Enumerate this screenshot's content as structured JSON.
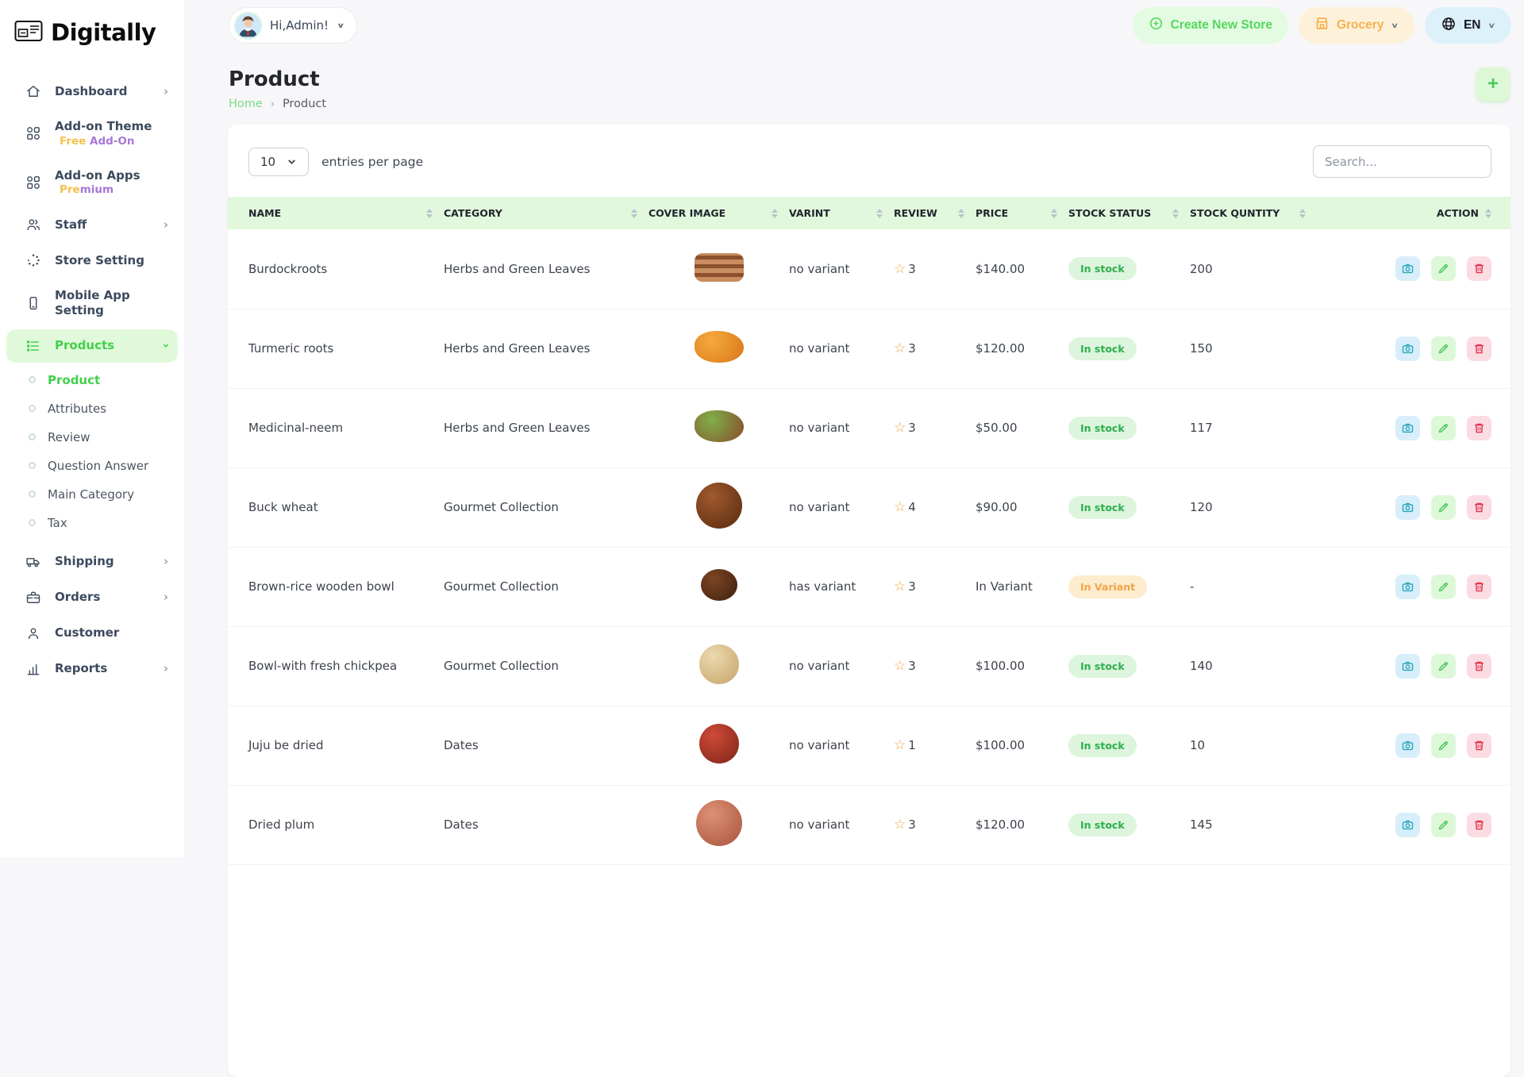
{
  "brand": {
    "name": "Digitally"
  },
  "topbar": {
    "greeting": "Hi,Admin!",
    "create_store_label": "Create New Store",
    "store_label": "Grocery",
    "language_label": "EN"
  },
  "page": {
    "title": "Product",
    "breadcrumb": {
      "home": "Home",
      "current": "Product"
    },
    "add_button": "+"
  },
  "controls": {
    "entries_value": "10",
    "entries_label": "entries per page",
    "search_placeholder": "Search..."
  },
  "sidebar": {
    "items": [
      {
        "label": "Dashboard",
        "icon": "home-icon",
        "chevron": true
      },
      {
        "label": "Add-on Theme",
        "icon": "grid-icon",
        "badge": [
          {
            "text": "Free",
            "color": "#f2c14e"
          },
          {
            "text": " Add-On",
            "color": "#a678d8"
          }
        ]
      },
      {
        "label": "Add-on Apps",
        "icon": "grid-icon",
        "badge": [
          {
            "text": "Pre",
            "color": "#f2c14e"
          },
          {
            "text": "mium",
            "color": "#a678d8"
          }
        ]
      },
      {
        "label": "Staff",
        "icon": "staff-icon",
        "chevron": true
      },
      {
        "label": "Store Setting",
        "icon": "spinner-icon"
      },
      {
        "label": "Mobile App Setting",
        "icon": "mobile-icon"
      },
      {
        "label": "Products",
        "icon": "list-icon",
        "chevron": true,
        "active": true,
        "children": [
          "Product",
          "Attributes",
          "Review",
          "Question Answer",
          "Main Category",
          "Tax"
        ],
        "active_child": "Product"
      },
      {
        "label": "Shipping",
        "icon": "truck-icon",
        "chevron": true
      },
      {
        "label": "Orders",
        "icon": "briefcase-icon",
        "chevron": true
      },
      {
        "label": "Customer",
        "icon": "customer-icon"
      },
      {
        "label": "Reports",
        "icon": "reports-icon",
        "chevron": true
      }
    ]
  },
  "table": {
    "columns": [
      "NAME",
      "CATEGORY",
      "COVER IMAGE",
      "VARINT",
      "REVIEW",
      "PRICE",
      "STOCK STATUS",
      "STOCK QUNTITY",
      "ACTION"
    ],
    "status_colors": {
      "stock": {
        "bg": "#dcf5dc",
        "text": "#2fae4e"
      },
      "variant": {
        "bg": "#fdeccd",
        "text": "#f2a44b"
      }
    },
    "rows": [
      {
        "name": "Burdockroots",
        "category": "Herbs and Green Leaves",
        "variant": "no variant",
        "review": "3",
        "price": "$140.00",
        "status": "In stock",
        "status_type": "stock",
        "quantity": "200",
        "img": {
          "shape": "logs",
          "c1": "#c98d5f",
          "c2": "#8a512c"
        }
      },
      {
        "name": "Turmeric roots",
        "category": "Herbs and Green Leaves",
        "variant": "no variant",
        "review": "3",
        "price": "$120.00",
        "status": "In stock",
        "status_type": "stock",
        "quantity": "150",
        "img": {
          "shape": "blob",
          "c1": "#f5a93f",
          "c2": "#d97716"
        }
      },
      {
        "name": "Medicinal-neem",
        "category": "Herbs and Green Leaves",
        "variant": "no variant",
        "review": "3",
        "price": "$50.00",
        "status": "In stock",
        "status_type": "stock",
        "quantity": "117",
        "img": {
          "shape": "blob",
          "c1": "#7fb04a",
          "c2": "#8a4a2a"
        }
      },
      {
        "name": "Buck wheat",
        "category": "Gourmet Collection",
        "variant": "no variant",
        "review": "4",
        "price": "$90.00",
        "status": "In stock",
        "status_type": "stock",
        "quantity": "120",
        "img": {
          "shape": "circle-lg",
          "c1": "#a05a2e",
          "c2": "#57290f"
        }
      },
      {
        "name": "Brown-rice wooden bowl",
        "category": "Gourmet Collection",
        "variant": "has variant",
        "review": "3",
        "price": "In Variant",
        "status": "In Variant",
        "status_type": "variant",
        "quantity": "-",
        "img": {
          "shape": "circle-sm",
          "c1": "#7c4522",
          "c2": "#3f2010"
        }
      },
      {
        "name": "Bowl-with fresh chickpea",
        "category": "Gourmet Collection",
        "variant": "no variant",
        "review": "3",
        "price": "$100.00",
        "status": "In stock",
        "status_type": "stock",
        "quantity": "140",
        "img": {
          "shape": "circle-md",
          "c1": "#ecd9ae",
          "c2": "#c5a369"
        }
      },
      {
        "name": "Juju be dried",
        "category": "Dates",
        "variant": "no variant",
        "review": "1",
        "price": "$100.00",
        "status": "In stock",
        "status_type": "stock",
        "quantity": "10",
        "img": {
          "shape": "circle-md",
          "c1": "#cf4a38",
          "c2": "#7e2418"
        }
      },
      {
        "name": "Dried plum",
        "category": "Dates",
        "variant": "no variant",
        "review": "3",
        "price": "$120.00",
        "status": "In stock",
        "status_type": "stock",
        "quantity": "145",
        "img": {
          "shape": "circle-lg",
          "c1": "#dd9076",
          "c2": "#a8543c"
        }
      }
    ]
  },
  "colors": {
    "primary_green": "#54d05f",
    "header_band": "#e2f8dd",
    "active_item_bg": "#e0f9da",
    "create_btn_bg": "#e2fbe1",
    "store_btn_bg": "#fdf1da",
    "store_btn_text": "#f5b14e",
    "lang_btn_bg": "#dcf1fa",
    "view_action": "#28a7b8",
    "edit_action": "#4cc45c",
    "delete_action": "#e6334d"
  }
}
